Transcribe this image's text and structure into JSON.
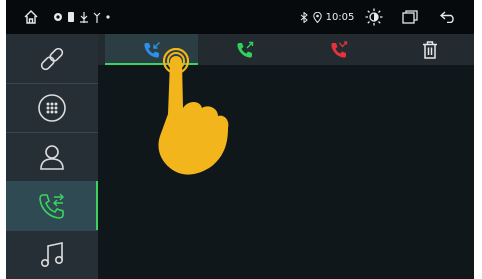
{
  "status_bar": {
    "time": "10:05",
    "icons": [
      "home-icon",
      "location-icon",
      "sim-card-icon",
      "usb-icon",
      "signal-antenna-icon",
      "dot-indicator",
      "bluetooth-icon",
      "location-pin-icon",
      "brightness-icon",
      "recent-apps-icon",
      "back-icon"
    ]
  },
  "sidebar": {
    "items": [
      {
        "icon": "link-icon",
        "active": false
      },
      {
        "icon": "dialpad-icon",
        "active": false
      },
      {
        "icon": "contacts-icon",
        "active": false
      },
      {
        "icon": "call-log-icon",
        "active": true
      },
      {
        "icon": "music-icon",
        "active": false
      }
    ]
  },
  "tabs": [
    {
      "icon": "incoming-call-icon",
      "active": true
    },
    {
      "icon": "outgoing-call-icon",
      "active": false
    },
    {
      "icon": "missed-call-icon",
      "active": false
    },
    {
      "icon": "delete-icon",
      "active": false
    }
  ],
  "colors": {
    "accent_green": "#3bd35e",
    "incoming_blue": "#2f8fe8",
    "outgoing_green": "#2fd15a",
    "missed_red": "#e8323a",
    "pointer_yellow": "#f2b51c"
  },
  "overlay": {
    "icon": "tap-pointer-hand-icon"
  }
}
